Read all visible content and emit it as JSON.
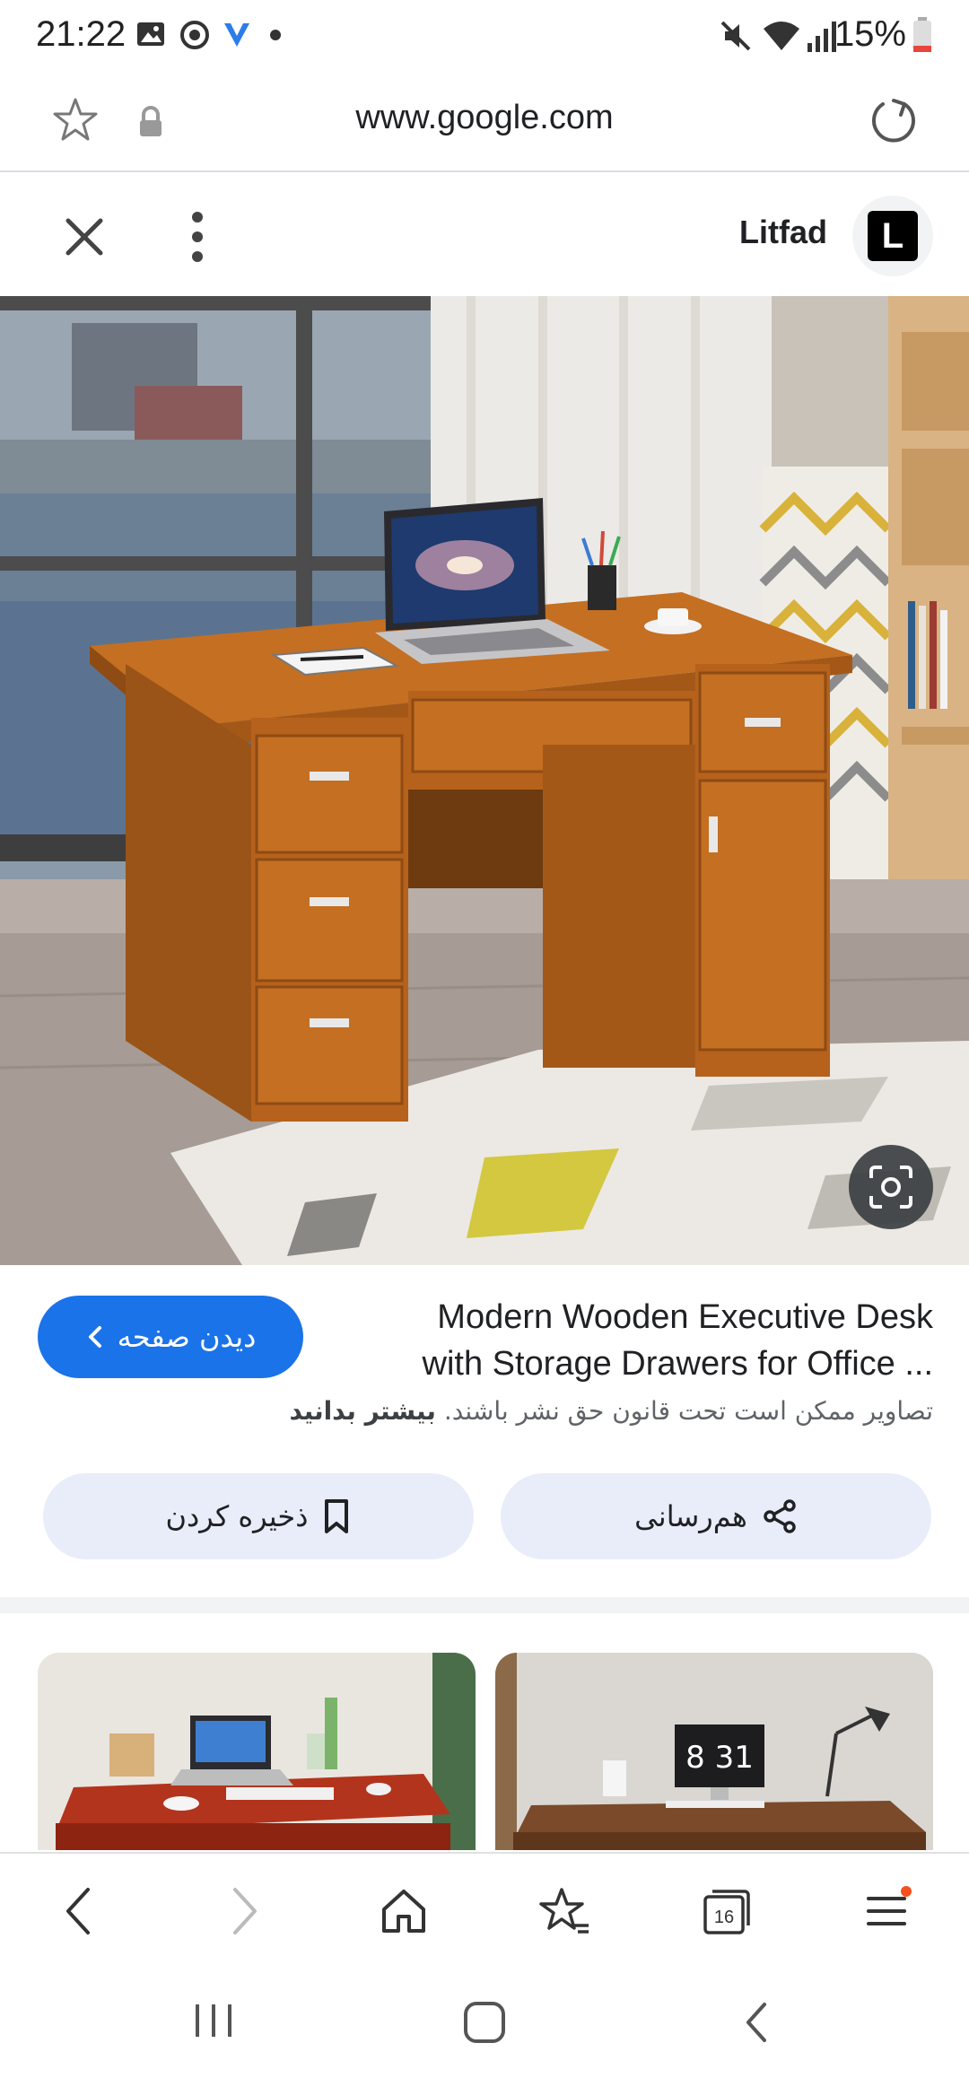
{
  "status_bar": {
    "time": "21:22",
    "battery": "15%"
  },
  "url_bar": {
    "url": "www.google.com"
  },
  "header": {
    "source_name": "Litfad",
    "source_logo_letter": "L"
  },
  "result": {
    "title_line1": "Modern Wooden Executive Desk",
    "title_line2": "with Storage Drawers for Office ...",
    "visit_label": "دیدن صفحه",
    "copyright_text": "تصاویر ممکن است تحت قانون حق نشر باشند.",
    "learn_more": "بیشتر بدانید"
  },
  "actions": {
    "share_label": "هم‌رسانی",
    "save_label": "ذخیره کردن"
  },
  "thumbnails": {
    "clock_text": "8 31"
  },
  "browser_nav": {
    "tabs_count": "16"
  },
  "colors": {
    "accent": "#1a73e8",
    "pill_bg": "#e8edf9",
    "notification_dot": "#f4511e"
  }
}
